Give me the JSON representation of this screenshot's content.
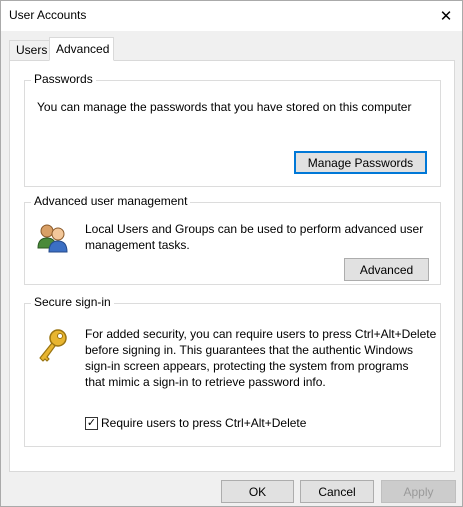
{
  "window": {
    "title": "User Accounts",
    "close_glyph": "✕"
  },
  "tabs": [
    {
      "label": "Users",
      "selected": false
    },
    {
      "label": "Advanced",
      "selected": true
    }
  ],
  "passwords": {
    "title": "Passwords",
    "description": "You can manage the passwords that you have stored on this computer",
    "button_label": "Manage Passwords"
  },
  "advanced_user_management": {
    "title": "Advanced user management",
    "description_line1": "Local Users and Groups can be used to perform advanced user",
    "description_line2": "management tasks.",
    "button_label": "Advanced",
    "icon": "users-group-icon"
  },
  "secure_sign_in": {
    "title": "Secure sign-in",
    "description_lines": [
      "For added security, you can require users to press Ctrl+Alt+Delete",
      "before signing in. This guarantees that the authentic Windows",
      "sign-in screen appears, protecting the system from programs",
      "that mimic a sign-in to retrieve password info."
    ],
    "checkbox_label": "Require users to press Ctrl+Alt+Delete",
    "checkbox_checked": true,
    "icon": "key-icon"
  },
  "footer": {
    "ok_label": "OK",
    "cancel_label": "Cancel",
    "apply_label": "Apply",
    "apply_enabled": false
  },
  "colors": {
    "accent": "#0078d7",
    "key_gold": "#e8b530"
  }
}
